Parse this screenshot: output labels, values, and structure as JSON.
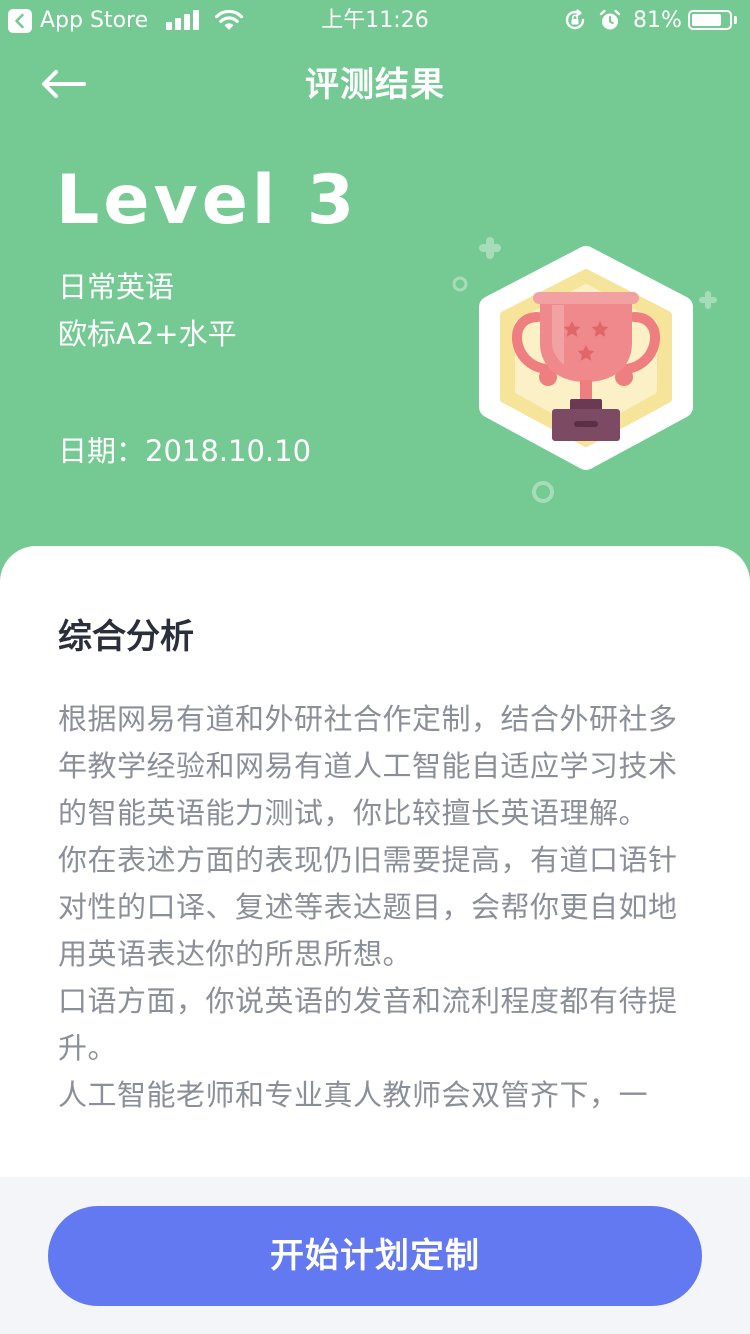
{
  "status_bar": {
    "back_app": "App Store",
    "time": "上午11:26",
    "battery": "81%",
    "battery_level": 0.81
  },
  "nav": {
    "title": "评测结果",
    "back_icon": "arrow-left-icon"
  },
  "result": {
    "level": "Level 3",
    "subtitle_1": "日常英语",
    "subtitle_2": "欧标A2+水平",
    "date": "日期：2018.10.10",
    "badge_icon": "trophy-badge-icon"
  },
  "analysis": {
    "title": "综合分析",
    "paragraphs": [
      "根据网易有道和外研社合作定制，结合外研社多年教学经验和网易有道人工智能自适应学习技术的智能英语能力测试，你比较擅长英语理解。",
      "你在表述方面的表现仍旧需要提高，有道口语针对性的口译、复述等表达题目，会帮你更自如地用英语表达你的所思所想。",
      "口语方面，你说英语的发音和流利程度都有待提升。",
      "人工智能老师和专业真人教师会双管齐下，一"
    ]
  },
  "footer": {
    "cta_label": "开始计划定制"
  },
  "colors": {
    "header_green": "#75C993",
    "cta_blue": "#6379F1",
    "title_text": "#2b2e3b",
    "body_text": "#8b8f99"
  }
}
